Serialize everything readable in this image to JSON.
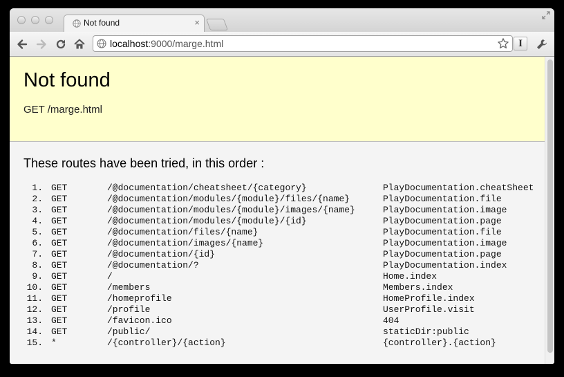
{
  "browser": {
    "tab_title": "Not found",
    "tab_close": "×",
    "url_host": "localhost",
    "url_rest": ":9000/marge.html",
    "ext_label": "I"
  },
  "page": {
    "title": "Not found",
    "request": "GET /marge.html",
    "routes_heading": "These routes have been tried, in this order :",
    "routes": [
      {
        "num": "1.",
        "method": "GET",
        "path": "/@documentation/cheatsheet/{category}",
        "action": "PlayDocumentation.cheatSheet"
      },
      {
        "num": "2.",
        "method": "GET",
        "path": "/@documentation/modules/{module}/files/{name}",
        "action": "PlayDocumentation.file"
      },
      {
        "num": "3.",
        "method": "GET",
        "path": "/@documentation/modules/{module}/images/{name}",
        "action": "PlayDocumentation.image"
      },
      {
        "num": "4.",
        "method": "GET",
        "path": "/@documentation/modules/{module}/{id}",
        "action": "PlayDocumentation.page"
      },
      {
        "num": "5.",
        "method": "GET",
        "path": "/@documentation/files/{name}",
        "action": "PlayDocumentation.file"
      },
      {
        "num": "6.",
        "method": "GET",
        "path": "/@documentation/images/{name}",
        "action": "PlayDocumentation.image"
      },
      {
        "num": "7.",
        "method": "GET",
        "path": "/@documentation/{id}",
        "action": "PlayDocumentation.page"
      },
      {
        "num": "8.",
        "method": "GET",
        "path": "/@documentation/?",
        "action": "PlayDocumentation.index"
      },
      {
        "num": "9.",
        "method": "GET",
        "path": "/",
        "action": "Home.index"
      },
      {
        "num": "10.",
        "method": "GET",
        "path": "/members",
        "action": "Members.index"
      },
      {
        "num": "11.",
        "method": "GET",
        "path": "/homeprofile",
        "action": "HomeProfile.index"
      },
      {
        "num": "12.",
        "method": "GET",
        "path": "/profile",
        "action": "UserProfile.visit"
      },
      {
        "num": "13.",
        "method": "GET",
        "path": "/favicon.ico",
        "action": "404"
      },
      {
        "num": "14.",
        "method": "GET",
        "path": "/public/",
        "action": "staticDir:public"
      },
      {
        "num": "15.",
        "method": "*",
        "path": "/{controller}/{action}",
        "action": "{controller}.{action}"
      }
    ]
  },
  "colors": {
    "banner": "#ffffcc",
    "page_bg": "#f4f4f4"
  },
  "icons": [
    "globe-icon",
    "close-icon",
    "back-arrow-icon",
    "forward-arrow-icon",
    "reload-icon",
    "home-icon",
    "star-icon",
    "wrench-icon",
    "fullscreen-icon"
  ]
}
